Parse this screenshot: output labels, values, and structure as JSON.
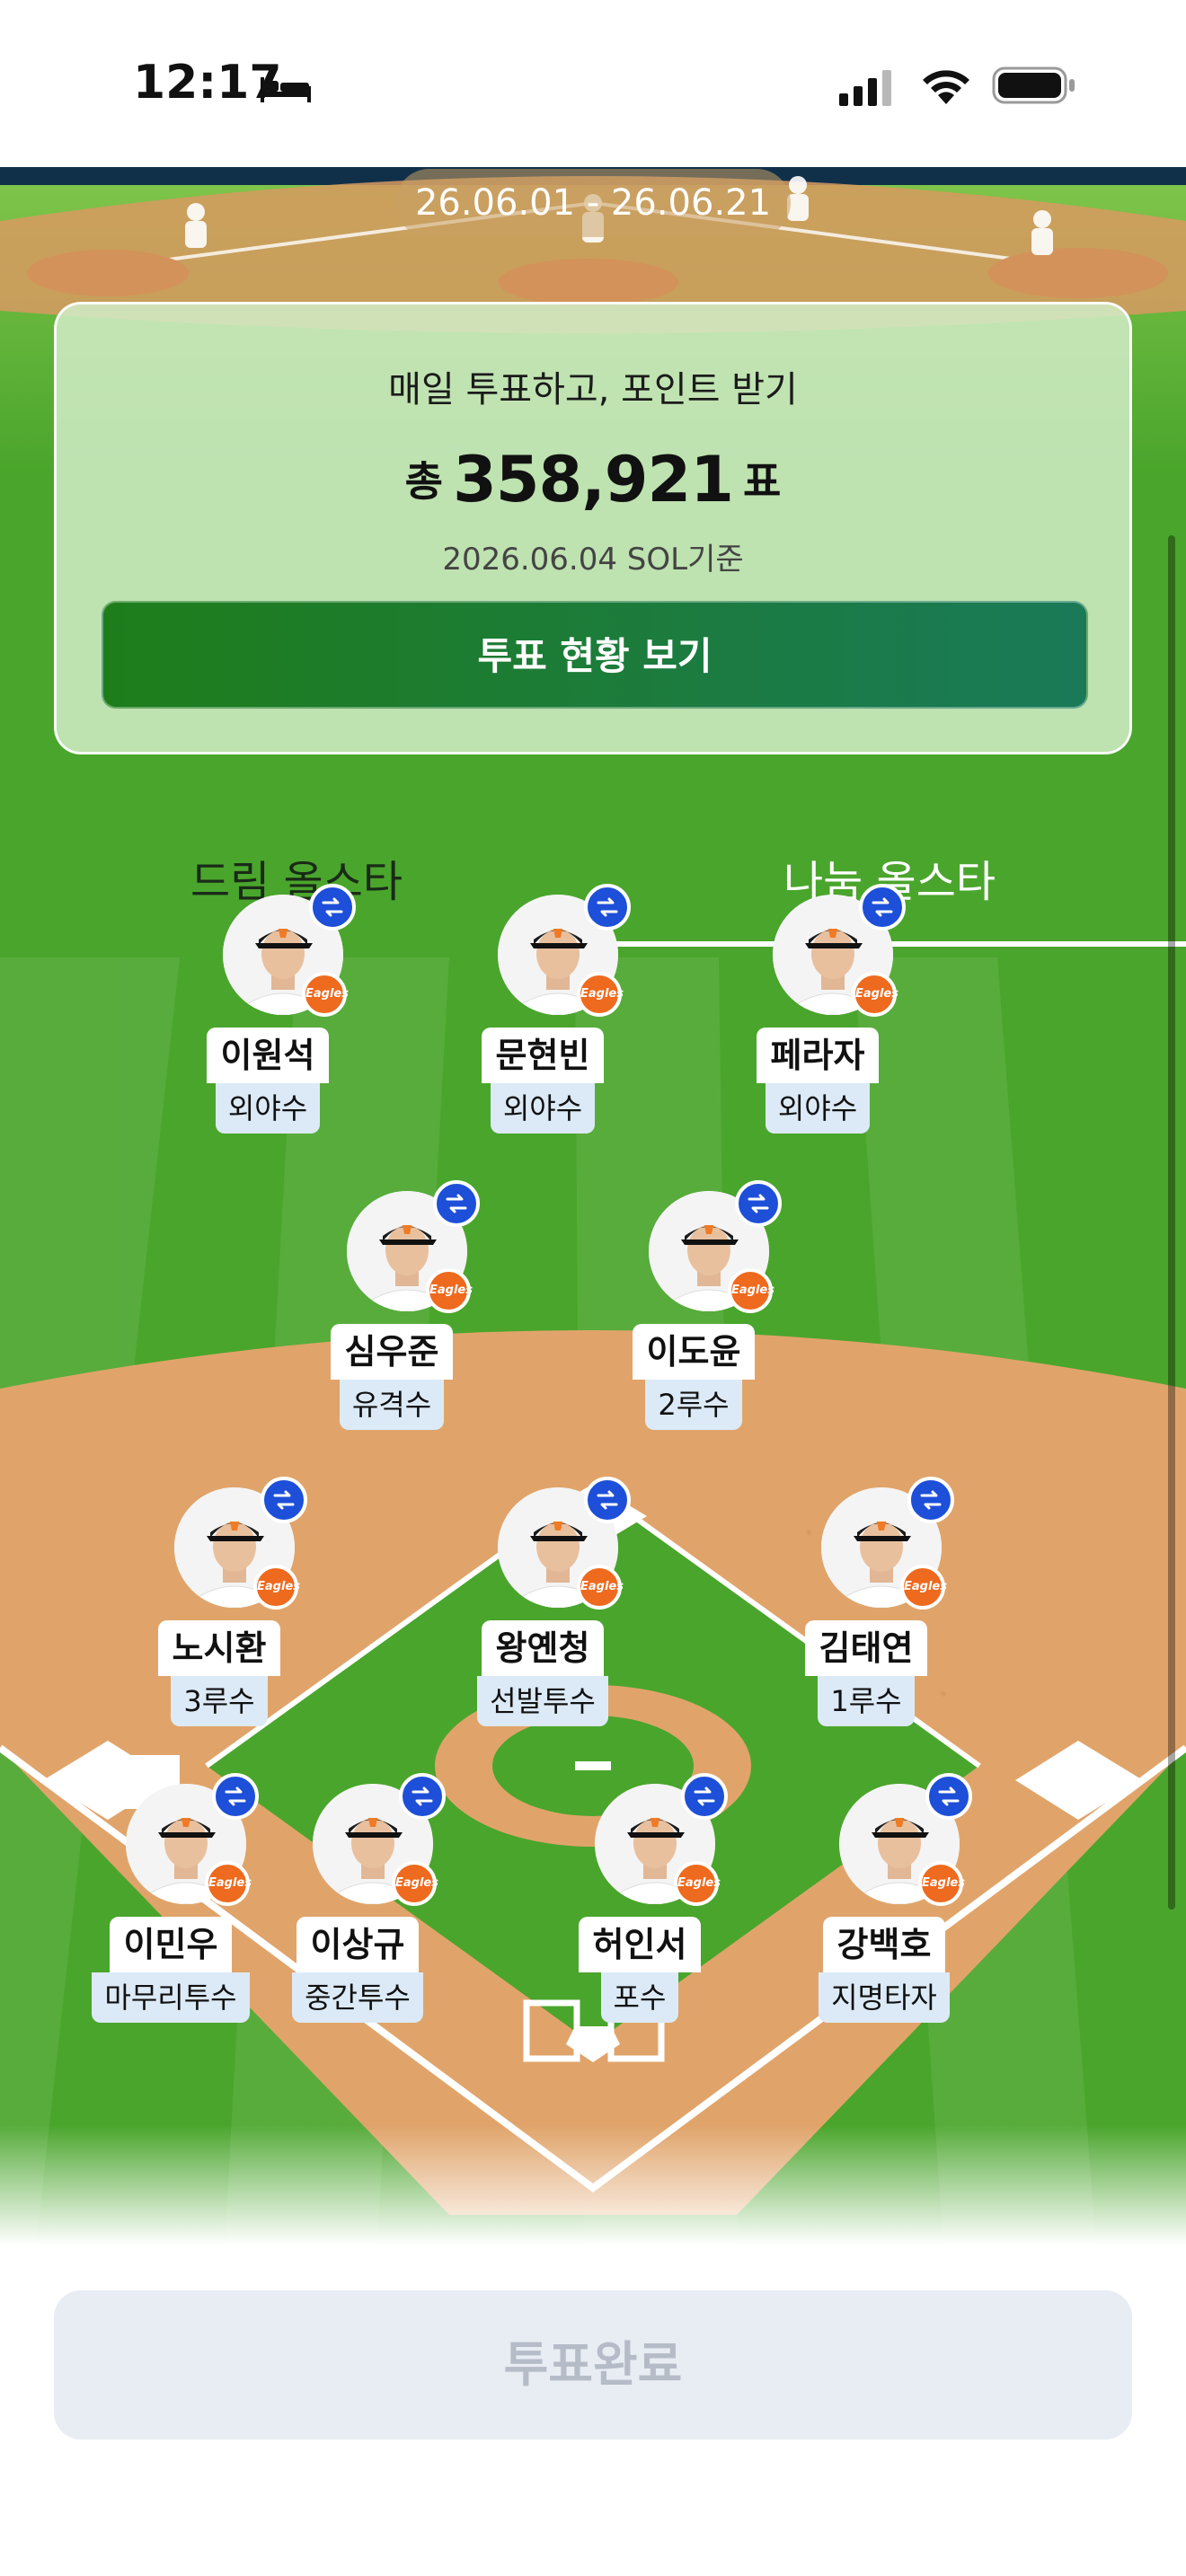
{
  "status_bar": {
    "time": "12:17"
  },
  "banner": {
    "date_range": "26.06.01 - 26.06.21"
  },
  "summary": {
    "headline": "매일 투표하고, 포인트 받기",
    "total_prefix": "총",
    "total_count": "358,921",
    "total_suffix": "표",
    "basis": "2026.06.04 SOL기준",
    "status_button": "투표 현황 보기"
  },
  "tabs": [
    {
      "label": "드림 올스타",
      "active": false
    },
    {
      "label": "나눔 올스타",
      "active": true
    }
  ],
  "team_badge": "Eagles",
  "players": [
    {
      "name": "이원석",
      "position": "외야수"
    },
    {
      "name": "문현빈",
      "position": "외야수"
    },
    {
      "name": "페라자",
      "position": "외야수"
    },
    {
      "name": "심우준",
      "position": "유격수"
    },
    {
      "name": "이도윤",
      "position": "2루수"
    },
    {
      "name": "노시환",
      "position": "3루수"
    },
    {
      "name": "왕옌청",
      "position": "선발투수"
    },
    {
      "name": "김태연",
      "position": "1루수"
    },
    {
      "name": "이민우",
      "position": "마무리투수"
    },
    {
      "name": "이상규",
      "position": "중간투수"
    },
    {
      "name": "허인서",
      "position": "포수"
    },
    {
      "name": "강백호",
      "position": "지명타자"
    }
  ],
  "footer": {
    "vote_button": "투표완료"
  },
  "colors": {
    "grass": "#4aa52c",
    "infield_dirt": "#e0a46a",
    "swap_badge": "#1d4fd8",
    "team_badge": "#ee6a1e",
    "primary_button": "#1e7d1a",
    "disabled_button": "#e8ecf3"
  }
}
